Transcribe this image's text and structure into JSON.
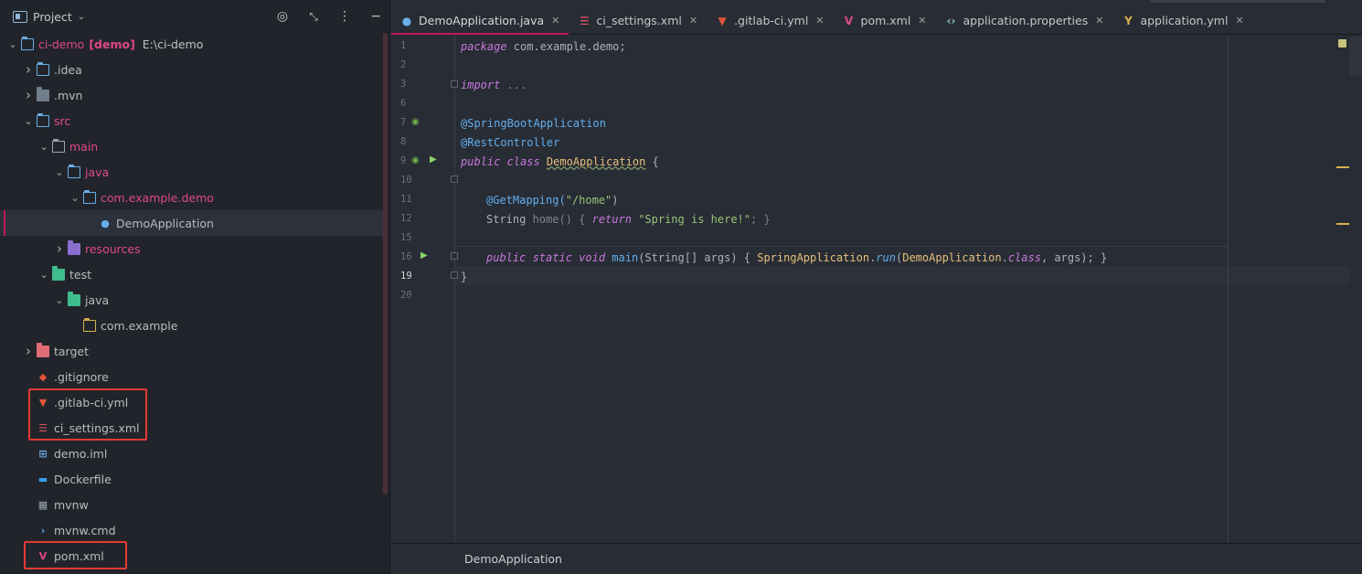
{
  "panel": {
    "title": "Project",
    "tools": [
      "target-icon",
      "collapse-icon",
      "more-icon",
      "minimize-icon"
    ]
  },
  "tree": [
    {
      "depth": 0,
      "arrow": "v",
      "icon": "module",
      "label": "ci-demo",
      "extra": "[demo]",
      "path": "E:\\ci-demo",
      "color": "pink"
    },
    {
      "depth": 1,
      "arrow": ">",
      "icon": "folder-idea",
      "label": ".idea"
    },
    {
      "depth": 1,
      "arrow": ">",
      "icon": "folder-plain",
      "label": ".mvn"
    },
    {
      "depth": 1,
      "arrow": "v",
      "icon": "folder-src",
      "label": "src",
      "color": "pink"
    },
    {
      "depth": 2,
      "arrow": "v",
      "icon": "folder-outline",
      "label": "main",
      "color": "pink"
    },
    {
      "depth": 3,
      "arrow": "v",
      "icon": "folder-blue",
      "label": "java",
      "color": "pink"
    },
    {
      "depth": 4,
      "arrow": "v",
      "icon": "folder-blue",
      "label": "com.example.demo",
      "color": "pink"
    },
    {
      "depth": 5,
      "arrow": "",
      "icon": "spring-class",
      "label": "DemoApplication",
      "selected": true
    },
    {
      "depth": 3,
      "arrow": ">",
      "icon": "folder-res",
      "label": "resources",
      "color": "pink"
    },
    {
      "depth": 2,
      "arrow": "v",
      "icon": "folder-green",
      "label": "test"
    },
    {
      "depth": 3,
      "arrow": "v",
      "icon": "folder-green",
      "label": "java"
    },
    {
      "depth": 4,
      "arrow": "",
      "icon": "folder-yellow",
      "label": "com.example"
    },
    {
      "depth": 1,
      "arrow": ">",
      "icon": "folder-red",
      "label": "target"
    },
    {
      "depth": 1,
      "arrow": "",
      "icon": "git",
      "label": ".gitignore"
    },
    {
      "depth": 1,
      "arrow": "",
      "icon": "gitlab",
      "label": ".gitlab-ci.yml"
    },
    {
      "depth": 1,
      "arrow": "",
      "icon": "xml-settings",
      "label": "ci_settings.xml"
    },
    {
      "depth": 1,
      "arrow": "",
      "icon": "iml",
      "label": "demo.iml"
    },
    {
      "depth": 1,
      "arrow": "",
      "icon": "docker",
      "label": "Dockerfile"
    },
    {
      "depth": 1,
      "arrow": "",
      "icon": "script",
      "label": "mvnw"
    },
    {
      "depth": 1,
      "arrow": "",
      "icon": "cmd",
      "label": "mvnw.cmd"
    },
    {
      "depth": 1,
      "arrow": "",
      "icon": "maven",
      "label": "pom.xml"
    }
  ],
  "tabs": [
    {
      "label": "DemoApplication.java",
      "icon": "spring-class",
      "active": true
    },
    {
      "label": "ci_settings.xml",
      "icon": "xml-settings"
    },
    {
      "label": ".gitlab-ci.yml",
      "icon": "gitlab"
    },
    {
      "label": "pom.xml",
      "icon": "maven"
    },
    {
      "label": "application.properties",
      "icon": "properties"
    },
    {
      "label": "application.yml",
      "icon": "yml"
    }
  ],
  "editor": {
    "line_numbers": [
      "1",
      "2",
      "3",
      "6",
      "7",
      "8",
      "9",
      "10",
      "11",
      "12",
      "15",
      "16",
      "19",
      "20"
    ],
    "current_line": "19",
    "code": {
      "l1_kw": "package",
      "l1_rest": " com.example.demo;",
      "l3_kw": "import",
      "l3_rest": " ...",
      "l7": "@SpringBootApplication",
      "l8": "@RestController",
      "l9_kw": "public class ",
      "l9_cls": "DemoApplication",
      "l9_rest": " {",
      "l11_ann": "@GetMapping(",
      "l11_str": "\"/home\"",
      "l11_end": ")",
      "l12_type": "String ",
      "l12_fn": "home",
      "l12_a": "() { ",
      "l12_kw": "return ",
      "l12_str": "\"Spring is here!\"",
      "l12_b": "; }",
      "l16_kw": "public static void ",
      "l16_fn": "main",
      "l16_a": "(String[] args) { ",
      "l16_cls": "SpringApplication",
      "l16_dot": ".",
      "l16_run": "run",
      "l16_b": "(",
      "l16_cls2": "DemoApplication",
      "l16_dot2": ".",
      "l16_kw2": "class",
      "l16_c": ", args); }",
      "l19": "}"
    }
  },
  "breadcrumb": "DemoApplication"
}
